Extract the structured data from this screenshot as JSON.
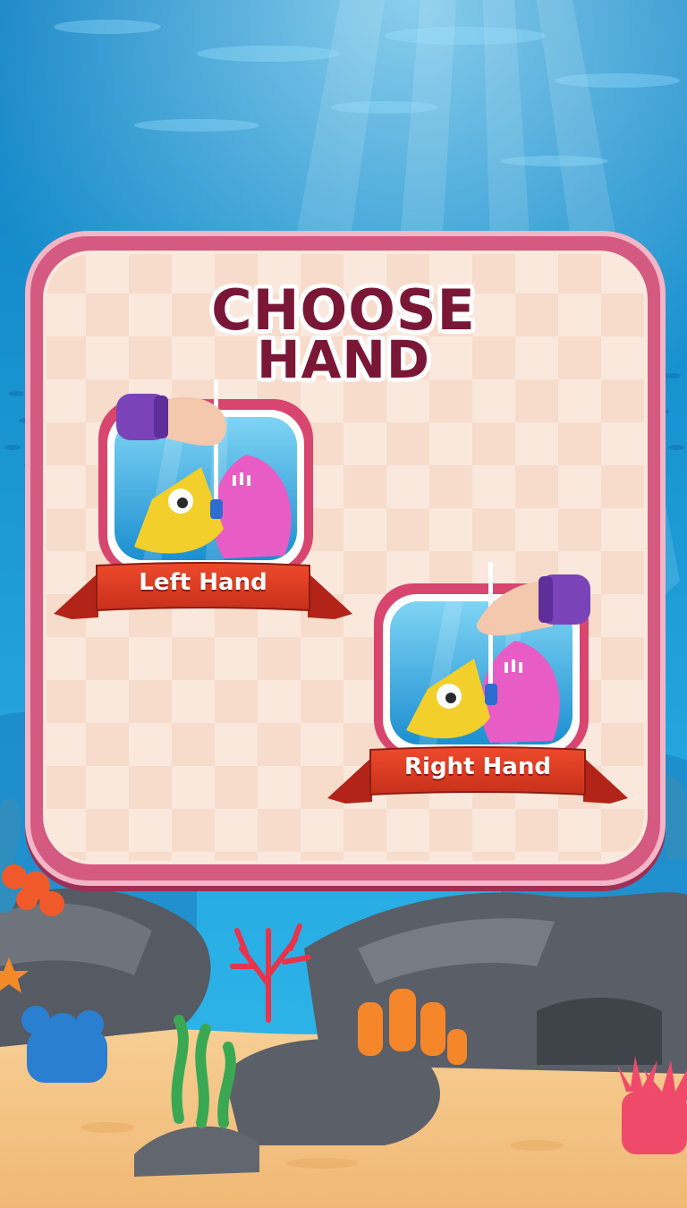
{
  "screen": {
    "title_line1": "CHOOSE",
    "title_line2": "HAND"
  },
  "choices": [
    {
      "id": "left",
      "label": "Left Hand"
    },
    {
      "id": "right",
      "label": "Right Hand"
    }
  ],
  "colors": {
    "water_top": "#0e86c9",
    "water_bottom": "#2ab0e6",
    "sand": "#f5c98f",
    "panel_border": "#d45a82",
    "panel_fill": "#f7dccb",
    "title": "#7a1737",
    "ribbon": "#d8361f",
    "fish": "#f2cf2a",
    "shell": "#e85cc6",
    "sleeve": "#7a44b8"
  }
}
